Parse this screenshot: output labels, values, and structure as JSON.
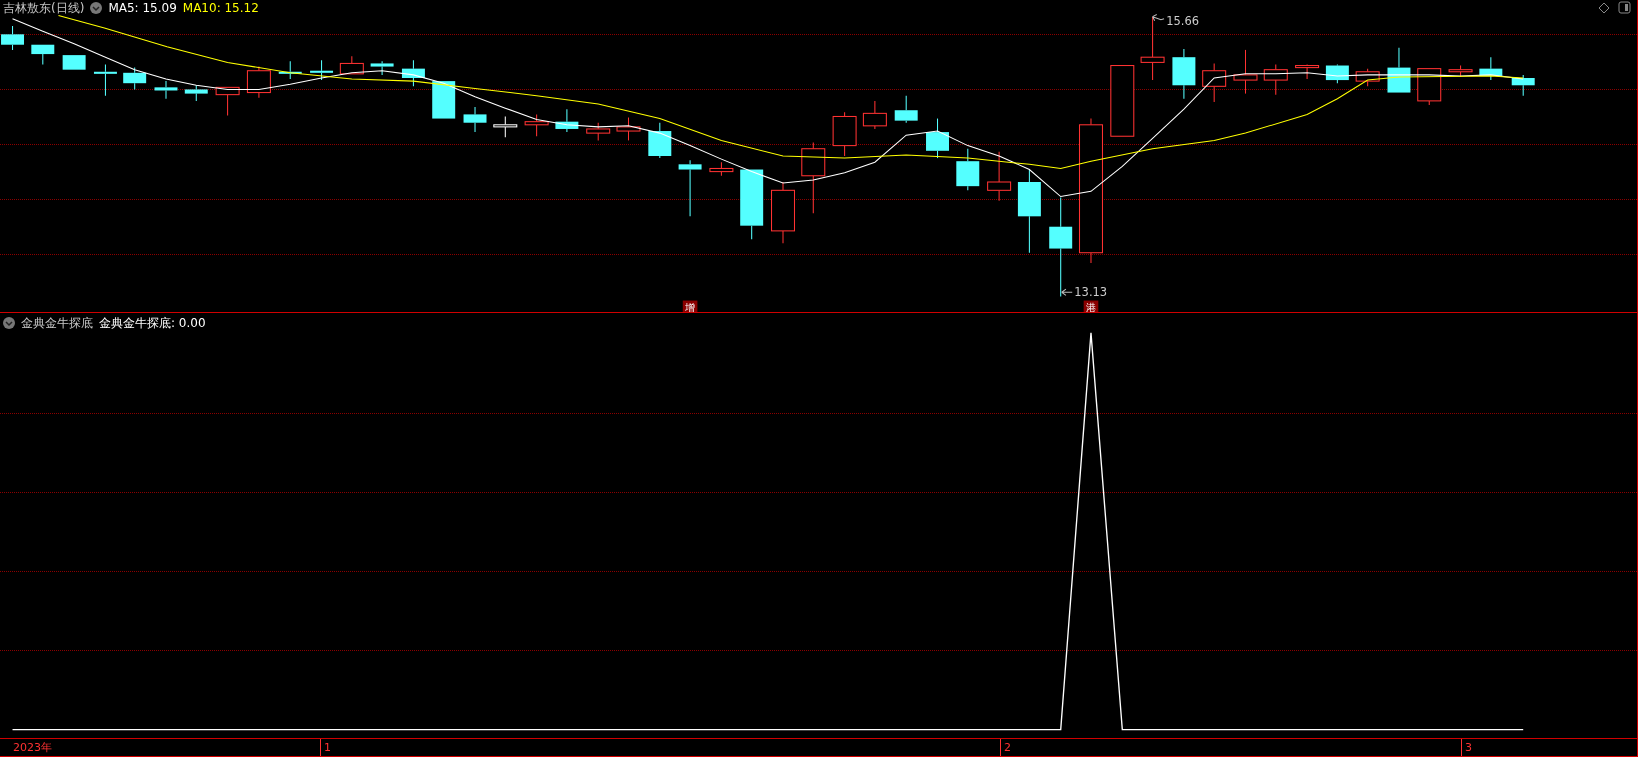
{
  "title": "吉林敖东(日线)",
  "ma": [
    {
      "label": "MA5: 15.09",
      "color": "#ffffff"
    },
    {
      "label": "MA10: 15.12",
      "color": "#ffff00"
    }
  ],
  "annotations": {
    "high": "15.66",
    "low": "13.13"
  },
  "markers": [
    "增",
    "港"
  ],
  "indicator": {
    "name": "金典金牛探底",
    "reading": "金典金牛探底: 0.00"
  },
  "time_axis": [
    "2023年",
    "1",
    "2",
    "3"
  ]
}
